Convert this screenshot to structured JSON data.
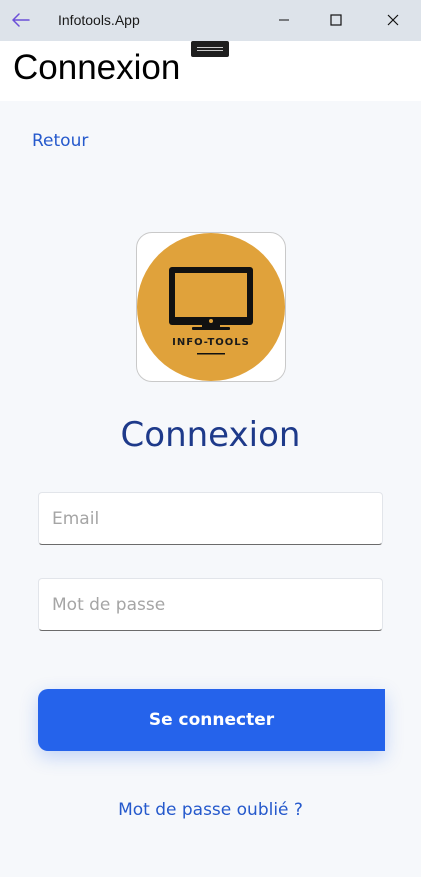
{
  "window": {
    "title": "Infotools.App",
    "icons": {
      "back": "arrow-left-icon",
      "minimize": "minimize-icon",
      "maximize": "maximize-icon",
      "close": "close-icon"
    },
    "accent_color": "#6b4fd8"
  },
  "header": {
    "title": "Connexion"
  },
  "nav": {
    "back_label": "Retour"
  },
  "logo": {
    "text": "INFO-TOOLS",
    "icon": "monitor-icon",
    "background_color": "#e0a23b"
  },
  "form": {
    "title": "Connexion",
    "email": {
      "value": "",
      "placeholder": "Email"
    },
    "password": {
      "value": "",
      "placeholder": "Mot de passe"
    },
    "submit_label": "Se connecter",
    "forgot_label": "Mot de passe oublié ?"
  },
  "colors": {
    "primary": "#2563eb",
    "title": "#1e3a8a",
    "link": "#2559cc",
    "background": "#f6f8fb"
  }
}
